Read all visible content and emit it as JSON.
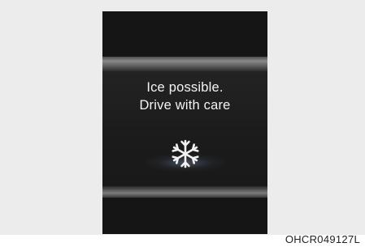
{
  "display": {
    "message_line_1": "Ice possible.",
    "message_line_2": "Drive with care",
    "icon": "snowflake-icon"
  },
  "figure": {
    "caption_code": "OHCR049127L"
  },
  "colors": {
    "screen_background": "#141414",
    "text": "#f4f4f4",
    "page_background": "#ececec"
  }
}
